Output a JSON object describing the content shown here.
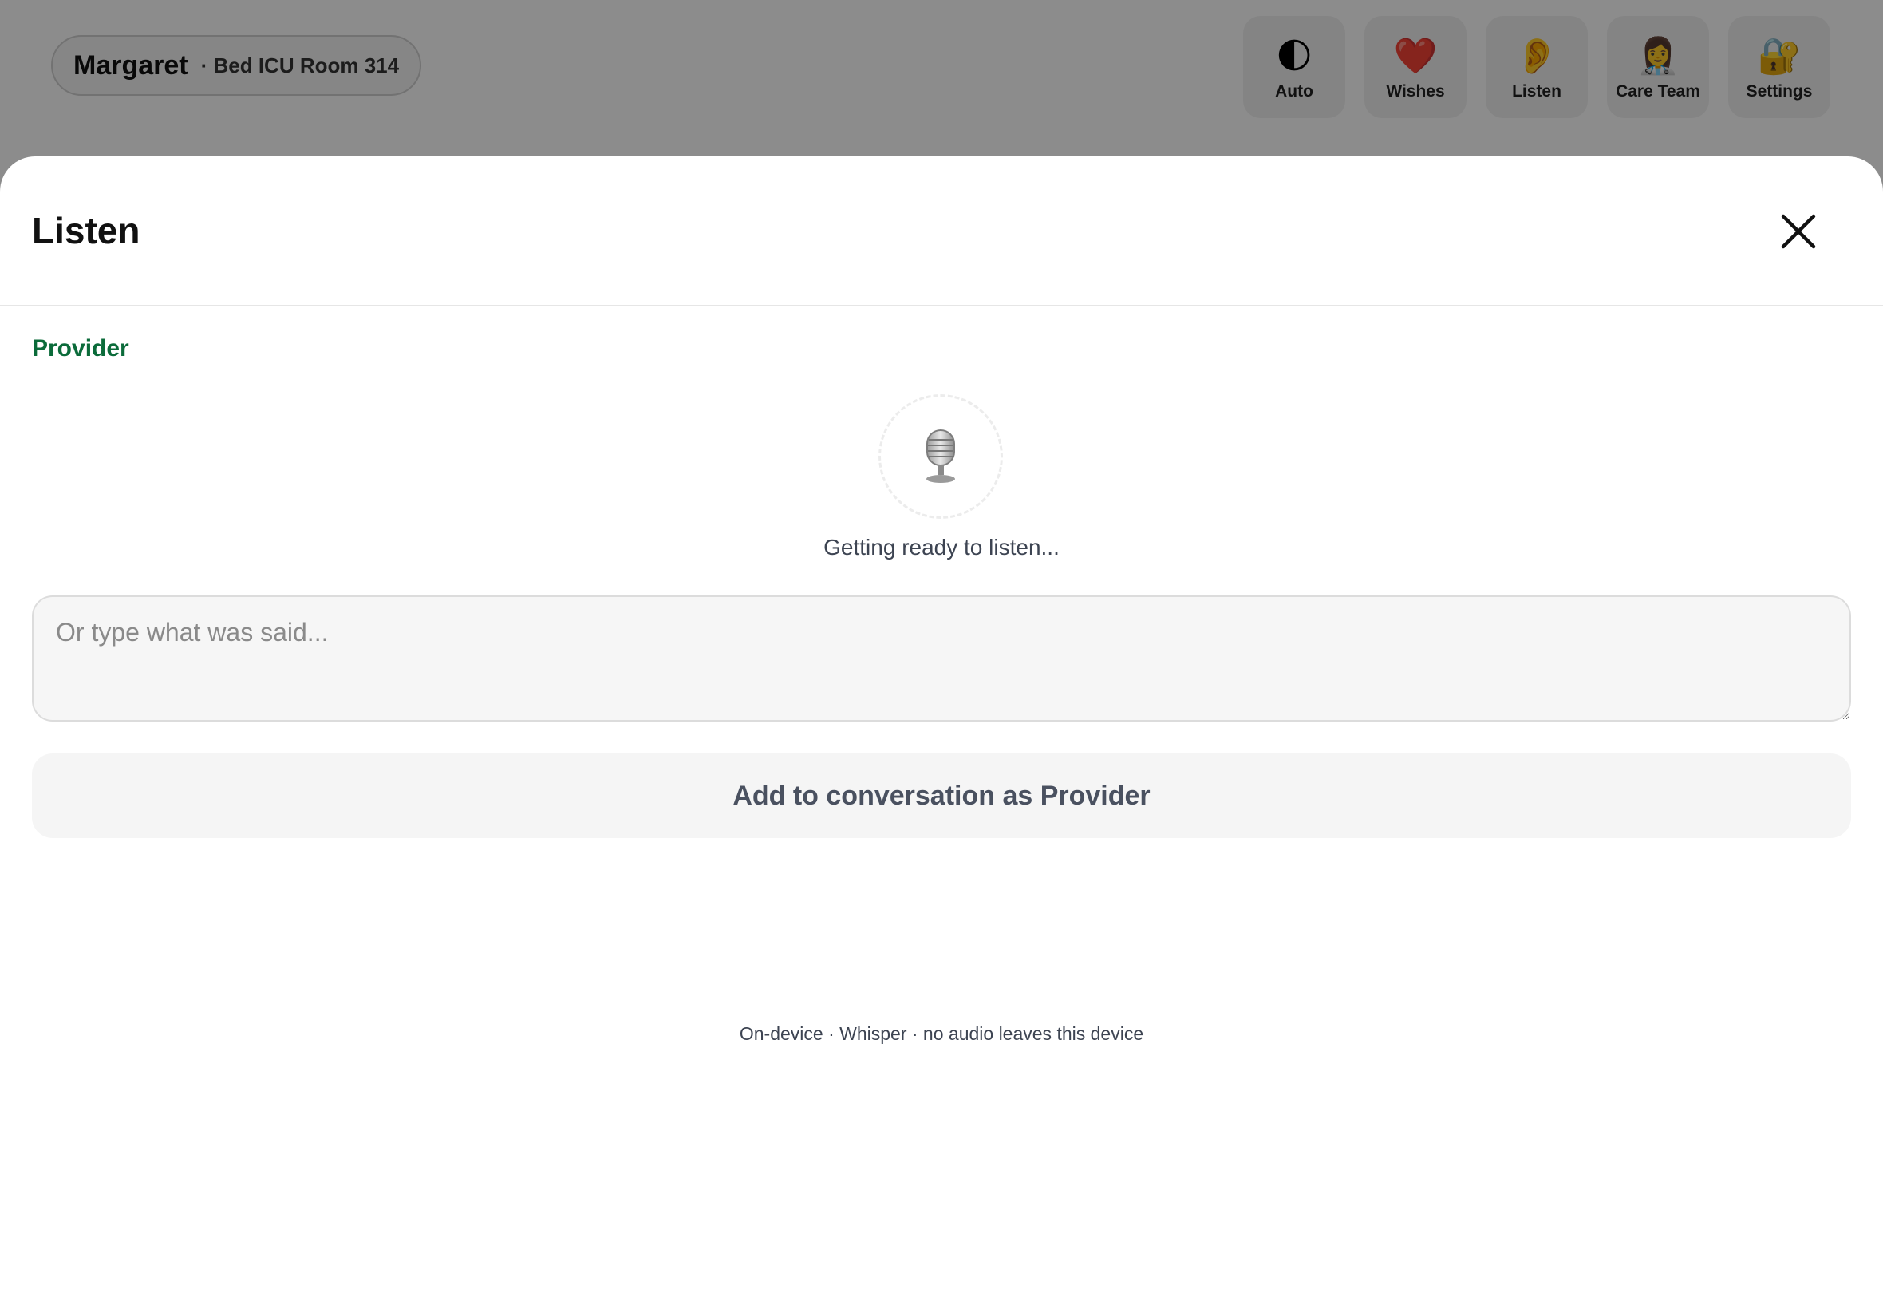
{
  "header": {
    "patient_name": "Margaret",
    "patient_location": "· Bed ICU Room 314"
  },
  "nav": [
    {
      "label": "Auto",
      "icon": "🌓",
      "icon_name": "half-moon-icon"
    },
    {
      "label": "Wishes",
      "icon": "❤️",
      "icon_name": "heart-icon"
    },
    {
      "label": "Listen",
      "icon": "👂",
      "icon_name": "ear-icon"
    },
    {
      "label": "Care Team",
      "icon": "👩‍⚕️",
      "icon_name": "health-worker-icon"
    },
    {
      "label": "Settings",
      "icon": "🔐",
      "icon_name": "lock-with-key-icon"
    }
  ],
  "sheet": {
    "title": "Listen",
    "speaker": "Provider",
    "mic_icon": "studio-microphone-icon",
    "status": "Getting ready to listen...",
    "input_placeholder": "Or type what was said...",
    "input_value": "",
    "add_button_label": "Add to conversation as Provider",
    "footnote": "On-device · Whisper · no audio leaves this device"
  },
  "colors": {
    "speaker_accent": "#0b6b3a",
    "overlay": "rgba(0,0,0,0.45)"
  }
}
